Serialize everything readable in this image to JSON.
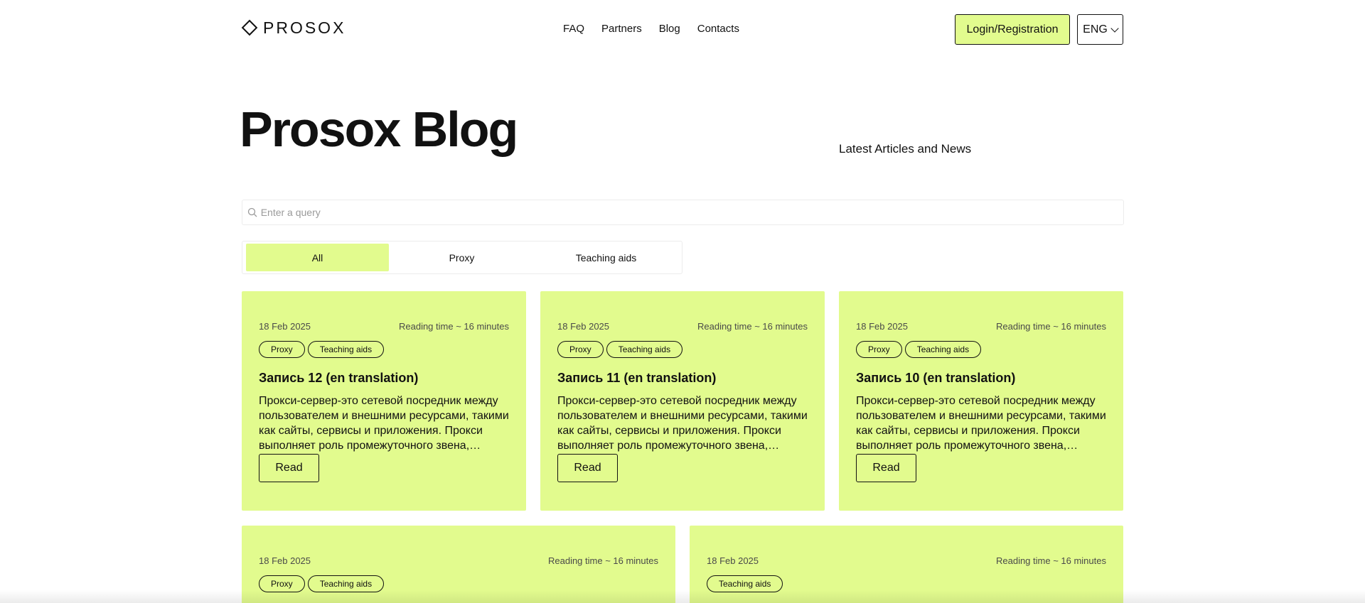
{
  "header": {
    "logo_text": "PROSOX",
    "nav": [
      "FAQ",
      "Partners",
      "Blog",
      "Contacts"
    ],
    "login_label": "Login/Registration",
    "lang_label": "ENG"
  },
  "hero": {
    "title": "Prosox Blog",
    "subtitle": "Latest Articles and News"
  },
  "search": {
    "placeholder": "Enter a query",
    "value": ""
  },
  "tabs": [
    {
      "label": "All",
      "active": true
    },
    {
      "label": "Proxy",
      "active": false
    },
    {
      "label": "Teaching aids",
      "active": false
    }
  ],
  "colors": {
    "accent": "#e2fb8e",
    "text": "#111111",
    "muted": "#4a4a4a"
  },
  "icons": {
    "search": "search-icon",
    "logo": "diamond-logo-icon",
    "dropdown": "chevron-down-icon"
  },
  "cards": [
    {
      "date": "18 Feb 2025",
      "reading_time": "Reading time ~ 16 minutes",
      "tags": [
        "Proxy",
        "Teaching aids"
      ],
      "title": "Запись 12 (en translation)",
      "excerpt": "Прокси-сервер-это сетевой посредник между пользователем и внешними ресурсами, такими как сайты, сервисы и приложения. Прокси выполняет роль промежуточного звена, через...",
      "read_label": "Read"
    },
    {
      "date": "18 Feb 2025",
      "reading_time": "Reading time ~ 16 minutes",
      "tags": [
        "Proxy",
        "Teaching aids"
      ],
      "title": "Запись 11 (en translation)",
      "excerpt": "Прокси-сервер-это сетевой посредник между пользователем и внешними ресурсами, такими как сайты, сервисы и приложения. Прокси выполняет роль промежуточного звена, через...",
      "read_label": "Read"
    },
    {
      "date": "18 Feb 2025",
      "reading_time": "Reading time ~ 16 minutes",
      "tags": [
        "Proxy",
        "Teaching aids"
      ],
      "title": "Запись 10 (en translation)",
      "excerpt": "Прокси-сервер-это сетевой посредник между пользователем и внешними ресурсами, такими как сайты, сервисы и приложения. Прокси выполняет роль промежуточного звена, через...",
      "read_label": "Read"
    },
    {
      "date": "18 Feb 2025",
      "reading_time": "Reading time ~ 16 minutes",
      "tags": [
        "Proxy",
        "Teaching aids"
      ]
    },
    {
      "date": "18 Feb 2025",
      "reading_time": "Reading time ~ 16 minutes",
      "tags": [
        "Teaching aids"
      ]
    }
  ]
}
